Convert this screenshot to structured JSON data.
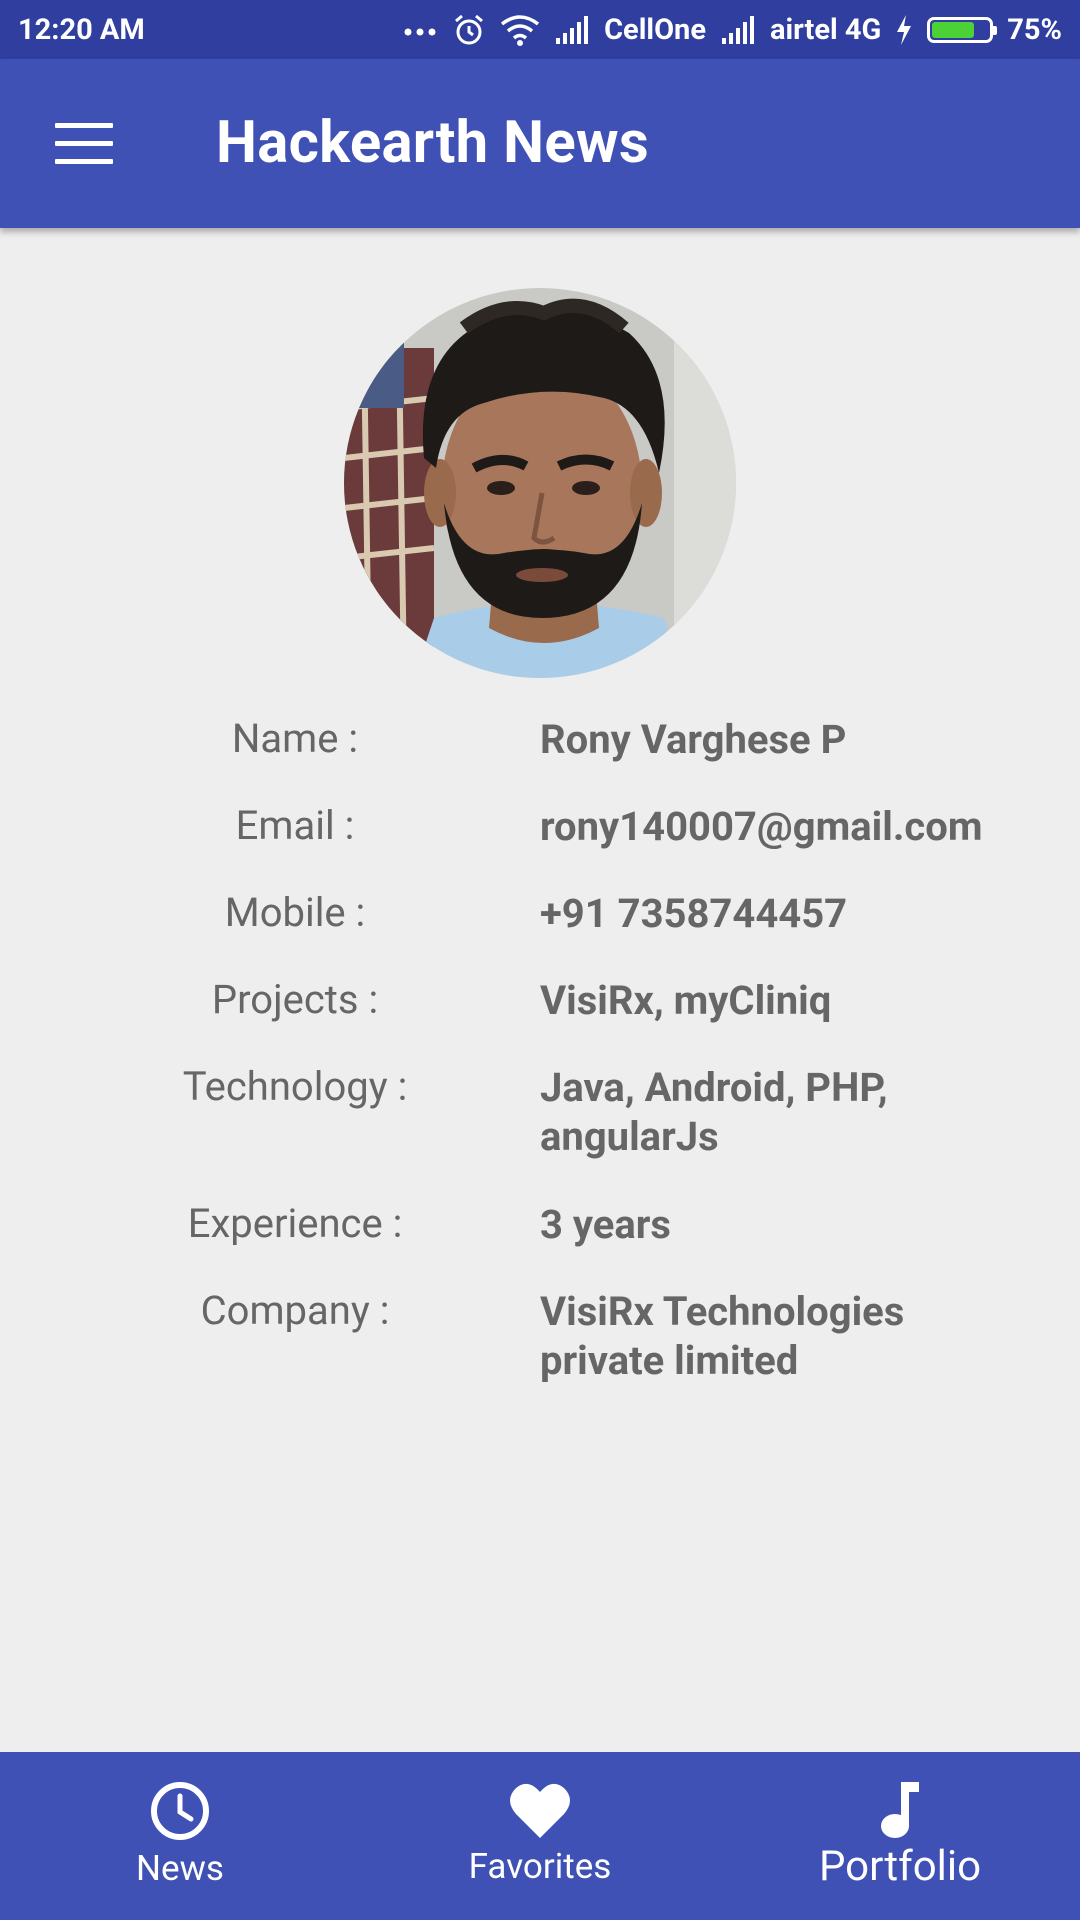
{
  "status_bar": {
    "time": "12:20 AM",
    "carrier_1": "CellOne",
    "carrier_2": "airtel 4G",
    "battery": "75%",
    "battery_level": 0.75,
    "icons": [
      "more-dots-icon",
      "alarm-icon",
      "wifi-icon",
      "signal-icon",
      "charging-icon",
      "battery-icon"
    ]
  },
  "app_bar": {
    "title": "Hackearth News",
    "menu_icon": "hamburger-menu-icon"
  },
  "profile": {
    "avatar": "profile-photo",
    "rows": [
      {
        "label": "Name :",
        "value": "Rony Varghese P"
      },
      {
        "label": "Email :",
        "value": "rony140007@gmail.com"
      },
      {
        "label": "Mobile :",
        "value": "+91 7358744457"
      },
      {
        "label": "Projects :",
        "value": "VisiRx, myCliniq"
      },
      {
        "label": "Technology :",
        "value": "Java, Android, PHP, angularJs"
      },
      {
        "label": "Experience :",
        "value": "3 years"
      },
      {
        "label": "Company :",
        "value": "VisiRx Technologies private limited"
      }
    ]
  },
  "bottom_nav": {
    "items": [
      {
        "label": "News",
        "icon": "clock-icon"
      },
      {
        "label": "Favorites",
        "icon": "heart-icon"
      },
      {
        "label": "Portfolio",
        "icon": "music-note-icon"
      }
    ],
    "active": "Portfolio"
  },
  "colors": {
    "primary": "#3f51b5",
    "primary_dark": "#303f9f",
    "background": "#eeeeee",
    "text": "#666666",
    "battery_fill": "#4cd137"
  }
}
